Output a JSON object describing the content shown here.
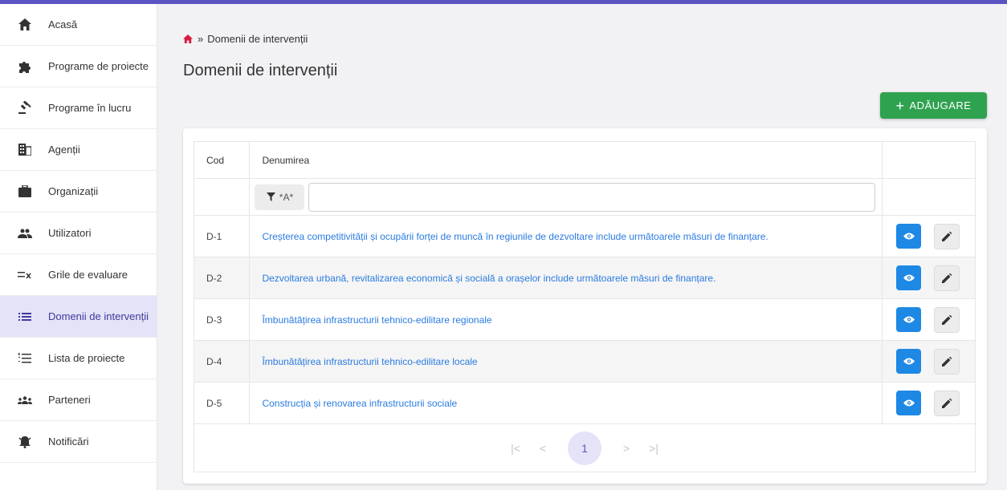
{
  "colors": {
    "accent": "#5b55c4",
    "add_button": "#2fa24f",
    "link": "#2a7be0",
    "view_button": "#1e88e5",
    "home_icon": "#d81b40"
  },
  "sidebar": {
    "items": [
      {
        "label": "Acasă",
        "icon": "home-icon"
      },
      {
        "label": "Programe de proiecte",
        "icon": "puzzle-icon"
      },
      {
        "label": "Programe în lucru",
        "icon": "gavel-icon"
      },
      {
        "label": "Agenții",
        "icon": "building-icon"
      },
      {
        "label": "Organizații",
        "icon": "briefcase-icon"
      },
      {
        "label": "Utilizatori",
        "icon": "people-icon"
      },
      {
        "label": "Grile de evaluare",
        "icon": "checklist-icon"
      },
      {
        "label": "Domenii de intervenții",
        "icon": "list-icon",
        "active": true
      },
      {
        "label": "Lista de proiecte",
        "icon": "numbered-list-icon"
      },
      {
        "label": "Parteneri",
        "icon": "group-icon"
      },
      {
        "label": "Notificări",
        "icon": "bell-icon"
      }
    ]
  },
  "breadcrumb": {
    "separator": "»",
    "current": "Domenii de intervenții"
  },
  "page_title": "Domenii de intervenții",
  "add_button": {
    "label": "ADĂUGARE"
  },
  "table": {
    "headers": {
      "code": "Cod",
      "name": "Denumirea"
    },
    "filter": {
      "label": "*A*",
      "value": ""
    },
    "rows": [
      {
        "code": "D-1",
        "name": "Creșterea competitivității și ocupării forței de muncă în regiunile de dezvoltare include următoarele măsuri de finanțare."
      },
      {
        "code": "D-2",
        "name": "Dezvoltarea urbană, revitalizarea economică și socială a orașelor include următoarele măsuri de finanțare."
      },
      {
        "code": "D-3",
        "name": "Îmbunătățirea infrastructurii tehnico-edilitare regionale"
      },
      {
        "code": "D-4",
        "name": "Îmbunătățirea infrastructurii tehnico-edilitare locale"
      },
      {
        "code": "D-5",
        "name": "Construcția și renovarea infrastructurii sociale"
      }
    ]
  },
  "pagination": {
    "first": "|<",
    "prev": "<",
    "current": "1",
    "next": ">",
    "last": ">|"
  }
}
